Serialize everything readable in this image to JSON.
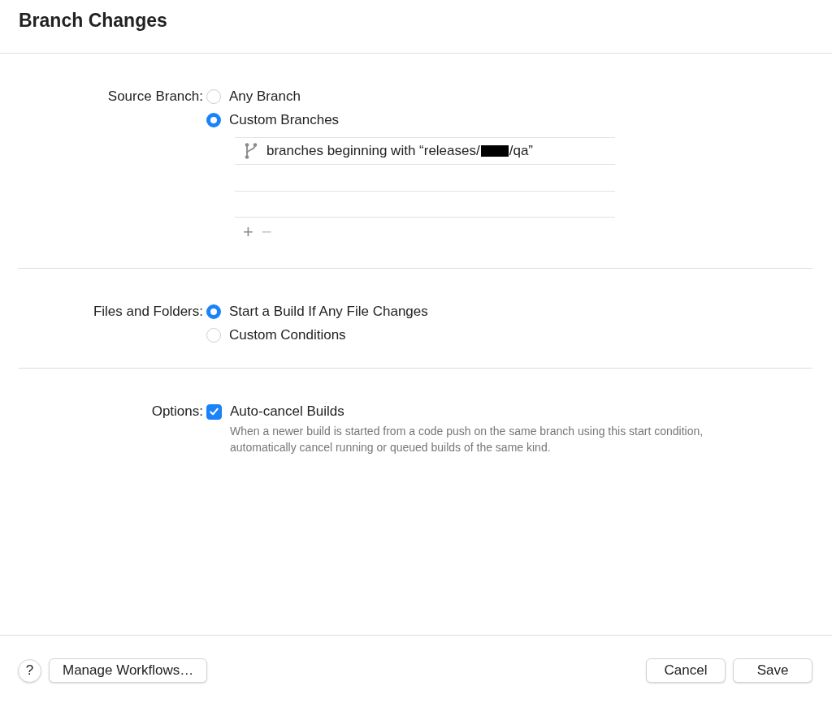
{
  "title": "Branch Changes",
  "sections": [
    {
      "label": "Source Branch:",
      "kind": "radio",
      "options": [
        {
          "label": "Any Branch",
          "selected": false
        },
        {
          "label": "Custom Branches",
          "selected": true
        }
      ],
      "branch_list": {
        "rows": [
          {
            "text_before": "branches beginning with “releases/",
            "redacted": true,
            "text_after": "/qa”"
          }
        ],
        "add": "+",
        "remove": "−"
      }
    },
    {
      "label": "Files and Folders:",
      "kind": "radio",
      "options": [
        {
          "label": "Start a Build If Any File Changes",
          "selected": true
        },
        {
          "label": "Custom Conditions",
          "selected": false
        }
      ]
    },
    {
      "label": "Options:",
      "kind": "checkbox",
      "options": [
        {
          "label": "Auto-cancel Builds",
          "checked": true,
          "description": "When a newer build is started from a code push on the same branch using this start condition, automatically cancel running or queued builds of the same kind."
        }
      ]
    }
  ],
  "footer": {
    "help": "?",
    "left_buttons": [
      "Manage Workflows…"
    ],
    "right_buttons": [
      "Cancel",
      "Save"
    ]
  }
}
